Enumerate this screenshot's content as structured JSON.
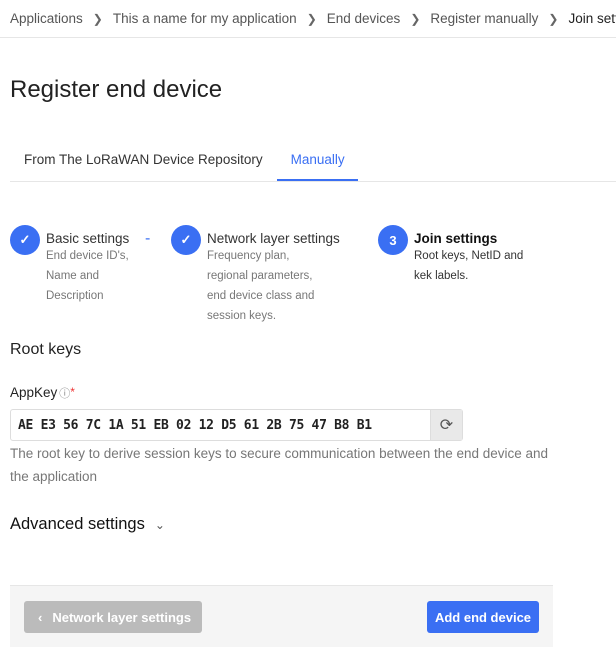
{
  "breadcrumb": [
    "Applications",
    "This a name for my application",
    "End devices",
    "Register manually",
    "Join settings"
  ],
  "title": "Register end device",
  "tabs": [
    "From The LoRaWAN Device Repository",
    "Manually"
  ],
  "steps": [
    {
      "title": "Basic settings",
      "desc": "End device ID's, Name and Description",
      "state": "done"
    },
    {
      "title": "Network layer settings",
      "desc": "Frequency plan, regional parameters, end device class and session keys.",
      "state": "done"
    },
    {
      "number": "3",
      "title": "Join settings",
      "desc": "Root keys, NetID and kek labels.",
      "state": "active"
    }
  ],
  "section": "Root keys",
  "appkey": {
    "label": "AppKey",
    "required": "*",
    "value": "AE E3 56 7C 1A 51 EB 02 12 D5 61 2B 75 47 B8 B1",
    "help": "The root key to derive session keys to secure communication between the end device and the application"
  },
  "advanced": "Advanced settings",
  "footer": {
    "back": "Network layer settings",
    "submit": "Add end device"
  },
  "accent": "#3a6ff3"
}
